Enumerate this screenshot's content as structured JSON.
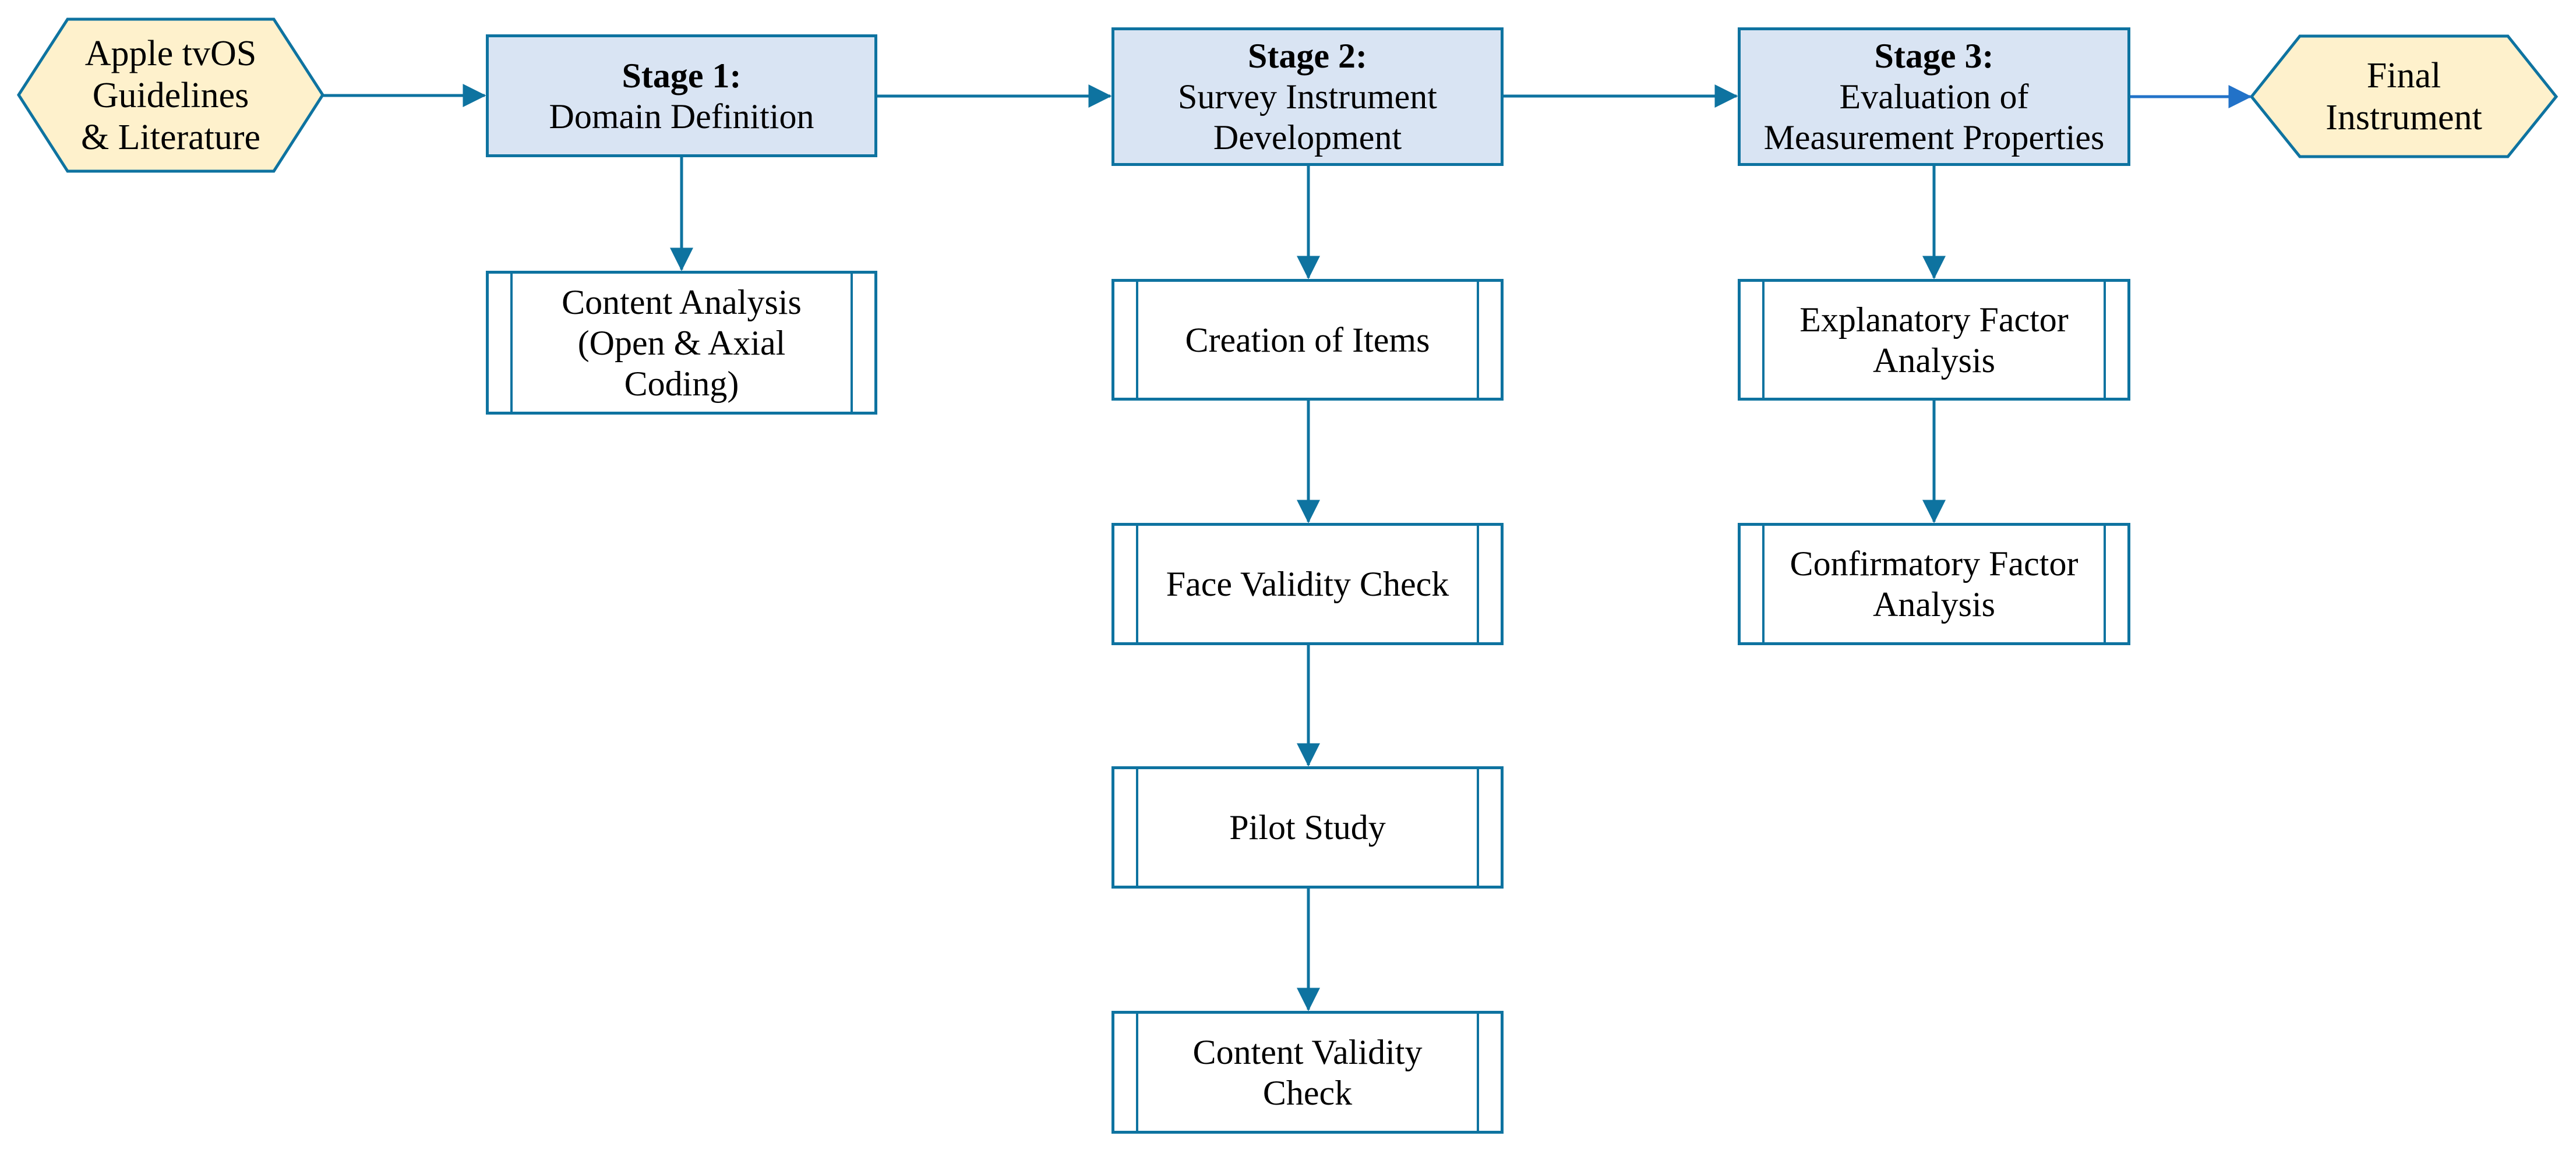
{
  "colors": {
    "stroke": "#0e73a0",
    "final_arrow": "#2272c8",
    "stage_fill": "#d9e4f3",
    "terminal_fill": "#fef1cc",
    "process_fill": "#ffffff"
  },
  "input": {
    "lines": [
      "Apple tvOS",
      "Guidelines",
      "& Literature"
    ]
  },
  "output": {
    "lines": [
      "Final",
      "Instrument"
    ]
  },
  "stages": [
    {
      "label": "Stage 1:",
      "lines": [
        "Domain Definition"
      ]
    },
    {
      "label": "Stage 2:",
      "lines": [
        "Survey Instrument",
        "Development"
      ]
    },
    {
      "label": "Stage 3:",
      "lines": [
        "Evaluation of",
        "Measurement Properties"
      ]
    }
  ],
  "stage1_steps": [
    {
      "lines": [
        "Content Analysis",
        "(Open & Axial",
        "Coding)"
      ]
    }
  ],
  "stage2_steps": [
    {
      "lines": [
        "Creation of Items"
      ]
    },
    {
      "lines": [
        "Face Validity Check"
      ]
    },
    {
      "lines": [
        "Pilot Study"
      ]
    },
    {
      "lines": [
        "Content Validity",
        "Check"
      ]
    }
  ],
  "stage3_steps": [
    {
      "lines": [
        "Explanatory Factor",
        "Analysis"
      ]
    },
    {
      "lines": [
        "Confirmatory Factor",
        "Analysis"
      ]
    }
  ]
}
